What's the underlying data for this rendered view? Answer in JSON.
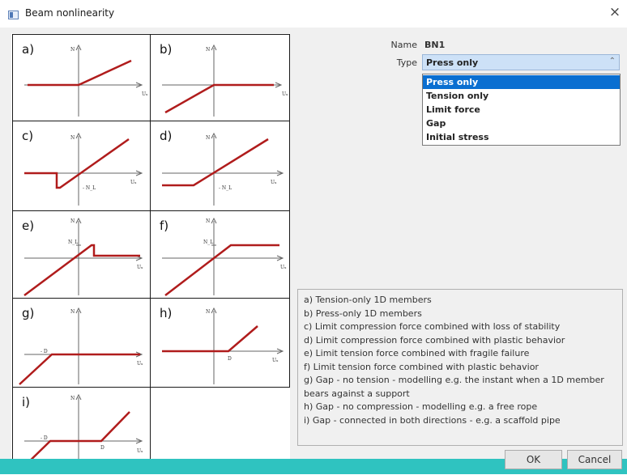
{
  "window": {
    "title": "Beam nonlinearity",
    "close_glyph": "×"
  },
  "diagrams": [
    {
      "label": "a)",
      "y_axis": "N",
      "x_axis": "Uₓ"
    },
    {
      "label": "b)",
      "y_axis": "N",
      "x_axis": "Uₓ"
    },
    {
      "label": "c)",
      "y_axis": "N",
      "x_axis": "Uₓ",
      "marker": "- N_L"
    },
    {
      "label": "d)",
      "y_axis": "N",
      "x_axis": "Uₓ",
      "marker": "- N_L"
    },
    {
      "label": "e)",
      "y_axis": "N",
      "x_axis": "Uₓ",
      "marker": "N_L"
    },
    {
      "label": "f)",
      "y_axis": "N",
      "x_axis": "Uₓ",
      "marker": "N_L"
    },
    {
      "label": "g)",
      "y_axis": "N",
      "x_axis": "Uₓ",
      "marker": "- D"
    },
    {
      "label": "h)",
      "y_axis": "N",
      "x_axis": "Uₓ",
      "marker": "D"
    },
    {
      "label": "i)",
      "y_axis": "N",
      "x_axis": "Uₓ",
      "marker": "- D",
      "marker2": "D"
    }
  ],
  "properties": {
    "name_label": "Name",
    "name_value": "BN1",
    "type_label": "Type",
    "type_value": "Press only",
    "type_options": [
      "Press only",
      "Tension only",
      "Limit force",
      "Gap",
      "Initial stress"
    ],
    "selected_option_index": 0
  },
  "description": [
    "a) Tension-only 1D members",
    "b) Press-only 1D members",
    "c) Limit compression force combined with loss of stability",
    "d) Limit compression force combined with plastic behavior",
    "e) Limit tension force combined with fragile failure",
    "f) Limit tension force combined with plastic behavior",
    "g) Gap - no tension - modelling e.g. the instant when a 1D member bears against a support",
    "h) Gap - no compression - modelling e.g. a free rope",
    "i) Gap - connected in both directions - e.g. a scaffold pipe"
  ],
  "buttons": {
    "ok": "OK",
    "cancel": "Cancel"
  },
  "colors": {
    "curve": "#b01c1c",
    "selection": "#0a6fd1",
    "accent_bar": "#2fc3c0"
  }
}
